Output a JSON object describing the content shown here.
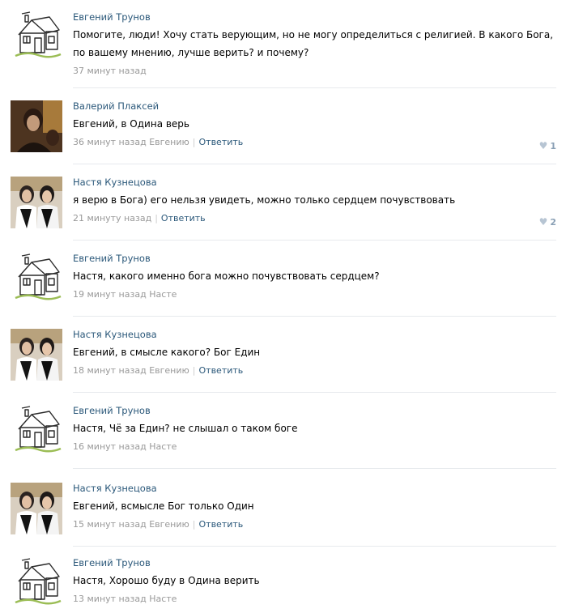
{
  "comments": [
    {
      "author": "Евгений Трунов",
      "avatar": "house-sketch",
      "text": "Помогите, люди! Хочу стать верующим, но не могу определиться с религией. В какого Бога, по вашему мнению, лучше верить? и почему?",
      "time": "37 минут назад",
      "to": "",
      "reply_label": "",
      "likes": ""
    },
    {
      "author": "Валерий Плаксей",
      "avatar": "photo-dark",
      "text": "Евгений, в Одина верь",
      "time": "36 минут назад",
      "to": "Евгению",
      "reply_label": "Ответить",
      "likes": "1"
    },
    {
      "author": "Настя Кузнецова",
      "avatar": "photo-two-people",
      "text": "я верю в Бога) его нельзя увидеть, можно только сердцем почувствовать",
      "time": "21 минуту назад",
      "to": "",
      "reply_label": "Ответить",
      "likes": "2"
    },
    {
      "author": "Евгений Трунов",
      "avatar": "house-sketch",
      "text": "Настя, какого именно бога можно почувствовать сердцем?",
      "time": "19 минут назад",
      "to": "Насте",
      "reply_label": "",
      "likes": ""
    },
    {
      "author": "Настя Кузнецова",
      "avatar": "photo-two-people",
      "text": "Евгений, в смысле какого? Бог Един",
      "time": "18 минут назад",
      "to": "Евгению",
      "reply_label": "Ответить",
      "likes": ""
    },
    {
      "author": "Евгений Трунов",
      "avatar": "house-sketch",
      "text": "Настя, Чё за Един? не слышал о таком боге",
      "time": "16 минут назад",
      "to": "Насте",
      "reply_label": "",
      "likes": ""
    },
    {
      "author": "Настя Кузнецова",
      "avatar": "photo-two-people",
      "text": "Евгений, всмысле Бог только Один",
      "time": "15 минут назад",
      "to": "Евгению",
      "reply_label": "Ответить",
      "likes": ""
    },
    {
      "author": "Евгений Трунов",
      "avatar": "house-sketch",
      "text": "Настя, Хорошо буду в Одина верить",
      "time": "13 минут назад",
      "to": "Насте",
      "reply_label": "",
      "likes": ""
    }
  ]
}
